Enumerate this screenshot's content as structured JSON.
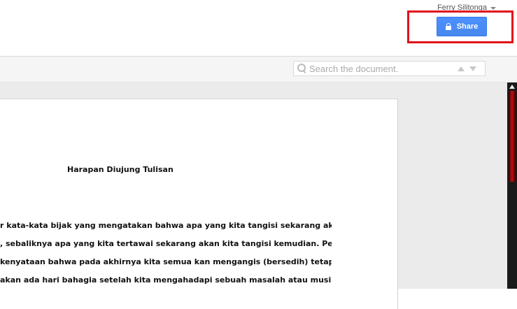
{
  "header": {
    "user_name": "Ferry Silitonga",
    "share_label": "Share"
  },
  "toolbar": {
    "search_placeholder": "Search the document."
  },
  "document": {
    "title": "Harapan Diujung Tulisan",
    "lines": [
      "r kata-kata bijak yang mengatakan bahwa apa yang kita tangisi sekarang akan",
      ", sebaliknya apa yang kita tertawai sekarang akan kita tangisi kemudian. Pepatah",
      "kenyataan bahwa pada akhirnya kita semua kan mengangis (bersedih) tetapi",
      "akan ada hari bahagia setelah kita mengahadapi sebuah masalah atau musibah."
    ]
  },
  "colors": {
    "share_button": "#4787ed",
    "highlight_box": "#e0121b",
    "scrollbar_thumb": "#c01010"
  }
}
